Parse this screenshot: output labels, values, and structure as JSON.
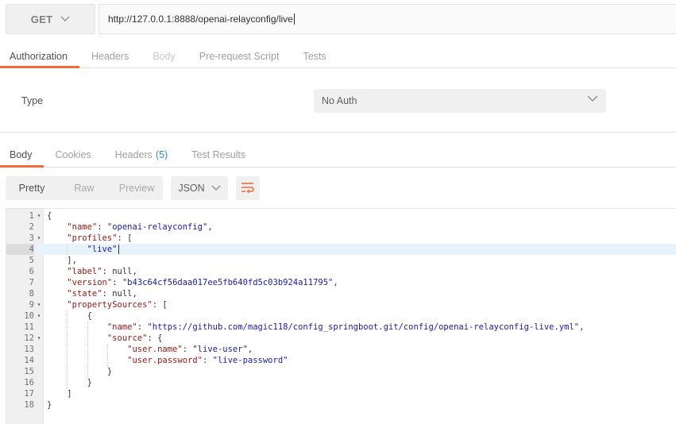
{
  "request": {
    "method": "GET",
    "url": "http://127.0.0.1:8888/openai-relayconfig/live"
  },
  "request_tabs": [
    {
      "label": "Authorization",
      "state": "active"
    },
    {
      "label": "Headers",
      "state": "normal"
    },
    {
      "label": "Body",
      "state": "disabled"
    },
    {
      "label": "Pre-request Script",
      "state": "normal"
    },
    {
      "label": "Tests",
      "state": "normal"
    }
  ],
  "auth": {
    "type_label": "Type",
    "type_value": "No Auth"
  },
  "response_tabs": {
    "body": "Body",
    "cookies": "Cookies",
    "headers": "Headers",
    "headers_count": "(5)",
    "test_results": "Test Results"
  },
  "toolbar": {
    "views": [
      "Pretty",
      "Raw",
      "Preview"
    ],
    "active_view": "Pretty",
    "language": "JSON",
    "wrap_icon": "wrap-lines-icon"
  },
  "editor": {
    "active_line": 4,
    "lines": [
      {
        "n": "1",
        "fold": true,
        "text": "{"
      },
      {
        "n": "2",
        "fold": false,
        "text": "    \"name\": \"openai-relayconfig\","
      },
      {
        "n": "3",
        "fold": true,
        "text": "    \"profiles\": ["
      },
      {
        "n": "4",
        "fold": false,
        "text": "        \"live\""
      },
      {
        "n": "5",
        "fold": false,
        "text": "    ],"
      },
      {
        "n": "6",
        "fold": false,
        "text": "    \"label\": null,"
      },
      {
        "n": "7",
        "fold": false,
        "text": "    \"version\": \"b43c64cf56daa017ee5fb640fd5c03b924a11795\","
      },
      {
        "n": "8",
        "fold": false,
        "text": "    \"state\": null,"
      },
      {
        "n": "9",
        "fold": true,
        "text": "    \"propertySources\": ["
      },
      {
        "n": "10",
        "fold": true,
        "text": "        {"
      },
      {
        "n": "11",
        "fold": false,
        "text": "            \"name\": \"https://github.com/magic118/config_springboot.git/config/openai-relayconfig-live.yml\","
      },
      {
        "n": "12",
        "fold": true,
        "text": "            \"source\": {"
      },
      {
        "n": "13",
        "fold": false,
        "text": "                \"user.name\": \"live-user\","
      },
      {
        "n": "14",
        "fold": false,
        "text": "                \"user.password\": \"live-password\""
      },
      {
        "n": "15",
        "fold": false,
        "text": "            }"
      },
      {
        "n": "16",
        "fold": false,
        "text": "        }"
      },
      {
        "n": "17",
        "fold": false,
        "text": "    ]"
      },
      {
        "n": "18",
        "fold": false,
        "text": "}"
      }
    ]
  },
  "colors": {
    "accent": "#f26b3a",
    "count_blue": "#2a8ad4",
    "json_key": "#951515",
    "json_string": "#1a1aa6"
  }
}
